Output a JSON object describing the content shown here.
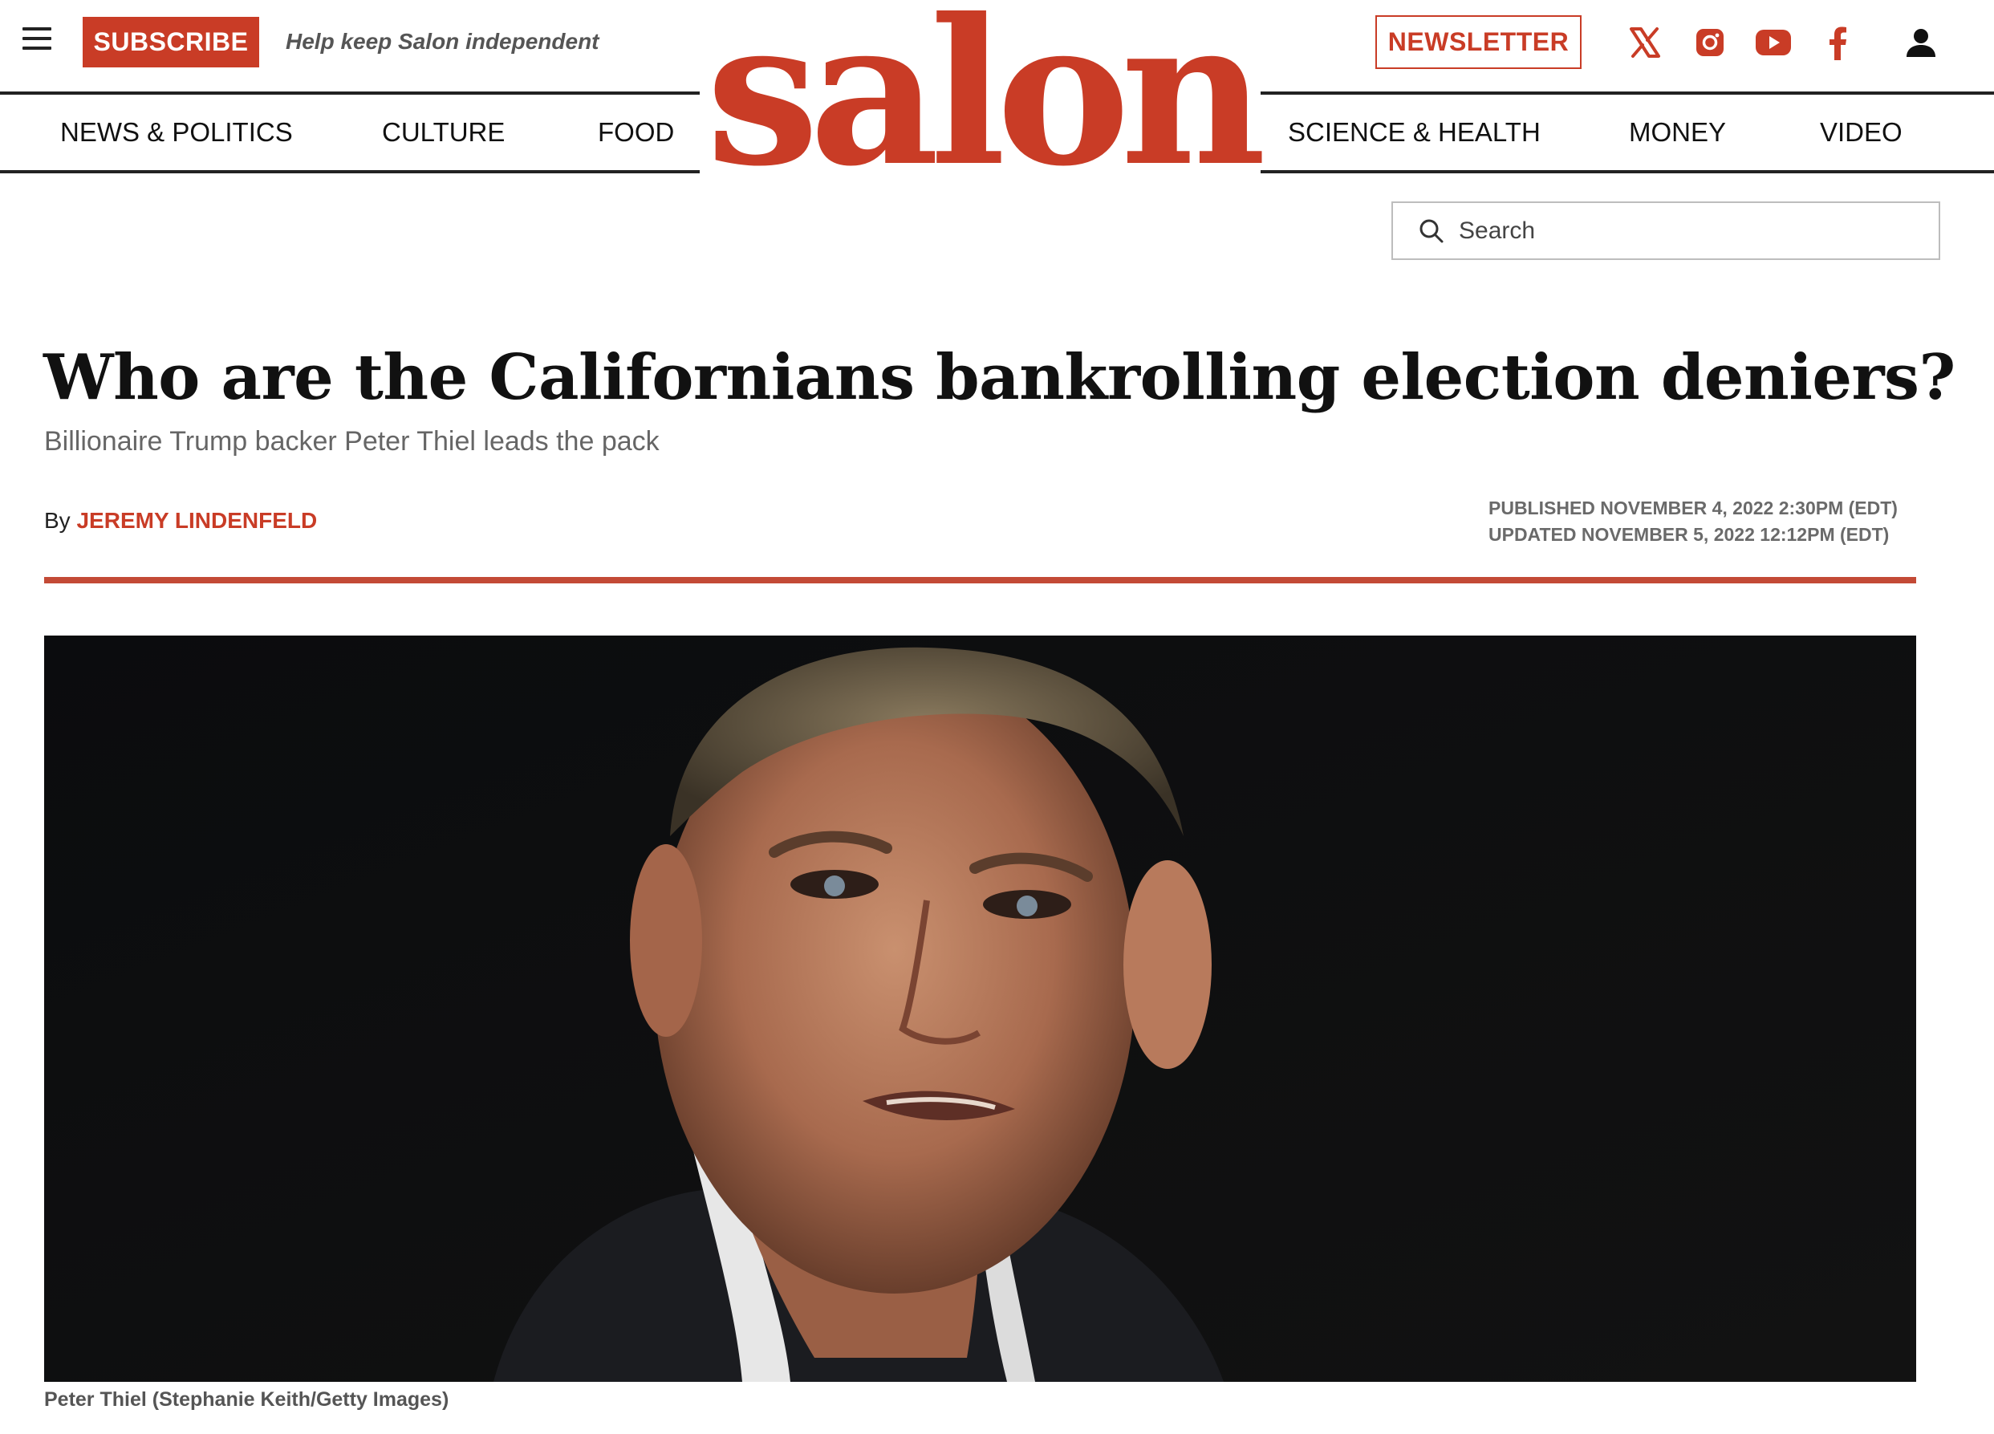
{
  "header": {
    "subscribe_label": "SUBSCRIBE",
    "tagline": "Help keep Salon independent",
    "newsletter_label": "NEWSLETTER",
    "logo_text": "salon",
    "social_icons": [
      "x-icon",
      "instagram-icon",
      "youtube-icon",
      "facebook-icon"
    ],
    "account_icon": "user-icon"
  },
  "nav": {
    "items": [
      "NEWS & POLITICS",
      "CULTURE",
      "FOOD",
      "SCIENCE & HEALTH",
      "MONEY",
      "VIDEO"
    ]
  },
  "search": {
    "placeholder": "Search"
  },
  "article": {
    "headline": "Who are the Californians bankrolling election deniers?",
    "subhead": "Billionaire Trump backer Peter Thiel leads the pack",
    "byline_prefix": "By",
    "author": "JEREMY LINDENFELD",
    "published": "PUBLISHED NOVEMBER 4, 2022 2:30PM (EDT)",
    "updated": "UPDATED NOVEMBER 5, 2022 12:12PM (EDT)",
    "photo_caption": "Peter Thiel (Stephanie Keith/Getty Images)"
  },
  "colors": {
    "brand_red": "#c93c26",
    "text_dark": "#111111",
    "text_gray": "#666666"
  }
}
